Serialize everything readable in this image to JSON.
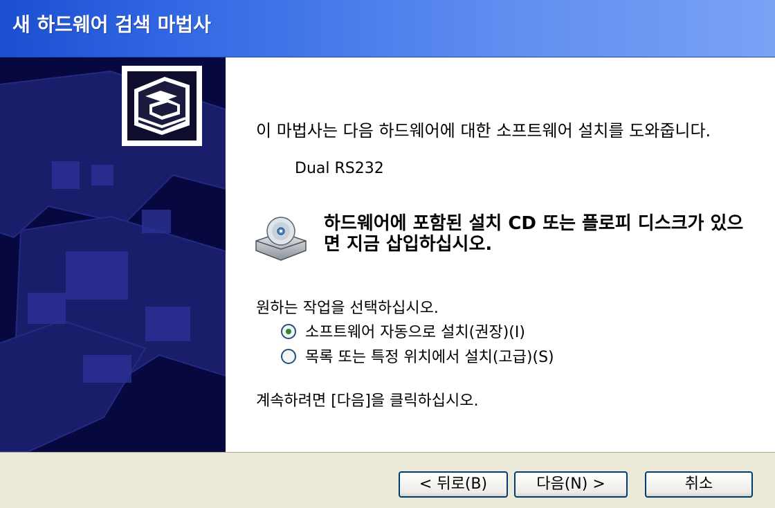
{
  "window": {
    "title": "새 하드웨어 검색 마법사"
  },
  "main": {
    "intro": "이 마법사는 다음 하드웨어에 대한 소프트웨어 설치를 도와줍니다.",
    "device": "Dual RS232",
    "cd_note": "하드웨어에 포함된 설치 CD 또는 플로피 디스크가 있으면 지금 삽입하십시오.",
    "prompt": "원하는 작업을 선택하십시오.",
    "options": [
      {
        "label": "소프트웨어 자동으로 설치(권장)(I)",
        "selected": true
      },
      {
        "label": "목록 또는 특정 위치에서 설치(고급)(S)",
        "selected": false
      }
    ],
    "continue": "계속하려면 [다음]을 클릭하십시오."
  },
  "buttons": {
    "back": "< 뒤로(B)",
    "next": "다음(N) >",
    "cancel": "취소"
  },
  "icons": {
    "hardware": "hardware-card-icon",
    "cd": "cd-drive-icon"
  }
}
